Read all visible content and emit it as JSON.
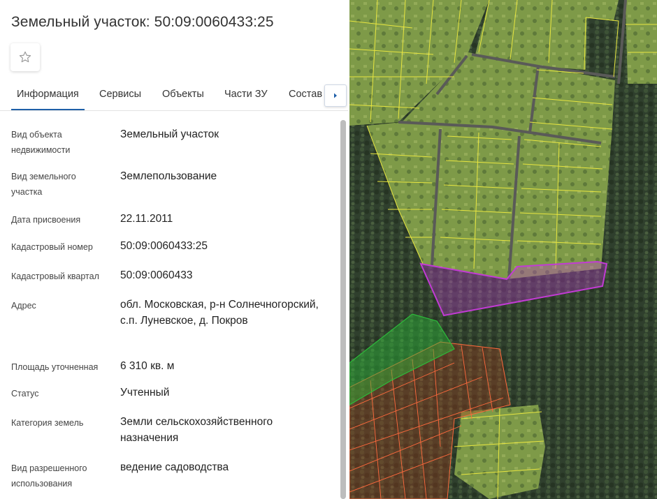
{
  "panel": {
    "title": "Земельный участок: 50:09:0060433:25",
    "favorite_icon": "star-outline-icon",
    "tabs": [
      {
        "label": "Информация",
        "active": true
      },
      {
        "label": "Сервисы",
        "active": false
      },
      {
        "label": "Объекты",
        "active": false
      },
      {
        "label": "Части ЗУ",
        "active": false
      },
      {
        "label": "Состав",
        "active": false
      }
    ],
    "tabs_next_icon": "chevron-right-icon",
    "accent_color": "#1e5fa8",
    "rows": [
      {
        "label": "Вид объекта недвижимости",
        "value": "Земельный участок"
      },
      {
        "label": "Вид земельного участка",
        "value": "Землепользование"
      },
      {
        "label": "Дата присвоения",
        "value": "22.11.2011"
      },
      {
        "label": "Кадастровый номер",
        "value": "50:09:0060433:25"
      },
      {
        "label": "Кадастровый квартал",
        "value": "50:09:0060433"
      },
      {
        "label": "Адрес",
        "value": "обл. Московская, р-н Солнечногорский, с.п. Луневское, д. Покров"
      },
      {
        "label": "Площадь уточненная",
        "value": "6 310 кв. м"
      },
      {
        "label": "Статус",
        "value": "Учтенный"
      },
      {
        "label": "Категория земель",
        "value": "Земли сельскохозяйственного назначения"
      },
      {
        "label": "Вид разрешенного использования",
        "value": "ведение садоводства"
      }
    ]
  },
  "map": {
    "type": "satellite",
    "parcel_boundary_color": "#e8e640",
    "selected_parcel_color": "#c23bd4",
    "forest_plot_color": "#ff6a3d",
    "green_zone_color": "#2dbb3a"
  }
}
